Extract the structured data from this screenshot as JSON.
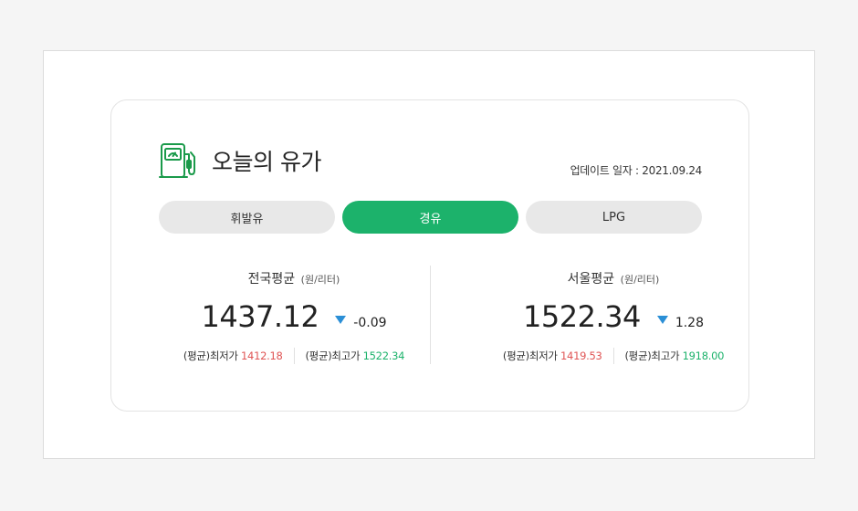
{
  "header": {
    "title": "오늘의 유가",
    "update_label": "업데이트 일자 : 2021.09.24",
    "icon": "fuel-pump-icon"
  },
  "tabs": [
    {
      "label": "휘발유",
      "active": false
    },
    {
      "label": "경유",
      "active": true
    },
    {
      "label": "LPG",
      "active": false
    }
  ],
  "national": {
    "title": "전국평균",
    "unit": "(원/리터)",
    "price": "1437.12",
    "change": "-0.09",
    "low_label": "(평균)최저가",
    "low_value": "1412.18",
    "high_label": "(평균)최고가",
    "high_value": "1522.34"
  },
  "seoul": {
    "title": "서울평균",
    "unit": "(원/리터)",
    "price": "1522.34",
    "change": "1.28",
    "low_label": "(평균)최저가",
    "low_value": "1419.53",
    "high_label": "(평균)최고가",
    "high_value": "1918.00"
  },
  "colors": {
    "accent": "#1cb26b",
    "low": "#e05555",
    "arrow": "#2b8fd6",
    "tab_bg": "#e8e8e8"
  }
}
